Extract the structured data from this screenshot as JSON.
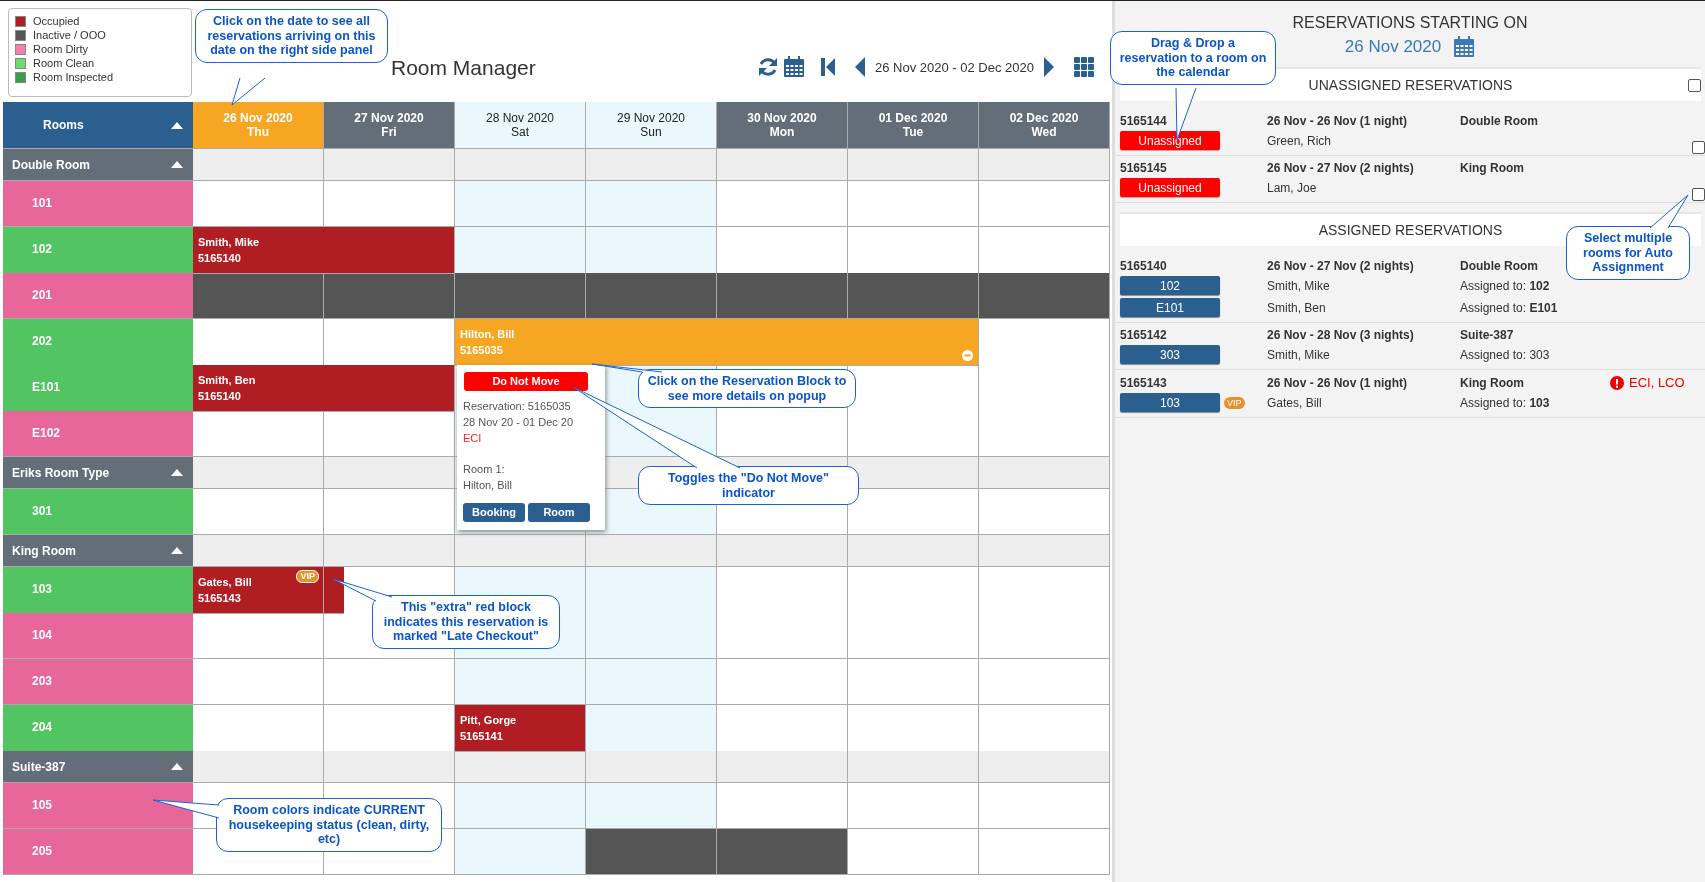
{
  "legend": [
    {
      "label": "Occupied",
      "color": "#b01e24"
    },
    {
      "label": "Inactive / OOO",
      "color": "#555555"
    },
    {
      "label": "Room Dirty",
      "color": "#f47fac"
    },
    {
      "label": "Room Clean",
      "color": "#6ddb6d"
    },
    {
      "label": "Room Inspected",
      "color": "#3a9d4a"
    }
  ],
  "title": "Room Manager",
  "toolbar": {
    "range": "26 Nov 2020 - 02 Dec 2020"
  },
  "calendar": {
    "rooms_header": "Rooms",
    "days": [
      {
        "date": "26 Nov 2020",
        "weekday": "Thu",
        "selected": true,
        "weekend": false
      },
      {
        "date": "27 Nov 2020",
        "weekday": "Fri",
        "selected": false,
        "weekend": false
      },
      {
        "date": "28 Nov 2020",
        "weekday": "Sat",
        "selected": false,
        "weekend": true
      },
      {
        "date": "29 Nov 2020",
        "weekday": "Sun",
        "selected": false,
        "weekend": true
      },
      {
        "date": "30 Nov 2020",
        "weekday": "Mon",
        "selected": false,
        "weekend": false
      },
      {
        "date": "01 Dec 2020",
        "weekday": "Tue",
        "selected": false,
        "weekend": false
      },
      {
        "date": "02 Dec 2020",
        "weekday": "Wed",
        "selected": false,
        "weekend": false
      }
    ],
    "groups": [
      {
        "name": "Double Room",
        "expanded": true,
        "rooms": [
          {
            "name": "101",
            "kind": "dirty",
            "cells": [
              {
                "kind": "free"
              },
              {
                "kind": "free"
              },
              {
                "kind": "free"
              },
              {
                "kind": "free"
              },
              {
                "kind": "free"
              },
              {
                "kind": "free"
              },
              {
                "kind": "free"
              }
            ]
          },
          {
            "name": "102",
            "kind": "clean",
            "cells": [
              {
                "kind": "occupied",
                "guest": "Smith, Mike",
                "number": "5165140",
                "selected": false,
                "late_checkout": false
              },
              {
                "kind": "continued"
              },
              {
                "kind": "free"
              },
              {
                "kind": "free"
              },
              {
                "kind": "free"
              },
              {
                "kind": "free"
              },
              {
                "kind": "free"
              }
            ]
          },
          {
            "name": "201",
            "kind": "dirty",
            "cells": [
              {
                "kind": "inactive"
              },
              {
                "kind": "inactive"
              },
              {
                "kind": "inactive"
              },
              {
                "kind": "inactive"
              },
              {
                "kind": "inactive"
              },
              {
                "kind": "inactive"
              },
              {
                "kind": "inactive"
              }
            ]
          },
          {
            "name": "202",
            "kind": "clean",
            "cells": [
              {
                "kind": "free"
              },
              {
                "kind": "free"
              },
              {
                "kind": "occupied",
                "guest": "Hilton, Bill",
                "number": "5165035",
                "selected": true,
                "late_checkout": false
              },
              {
                "kind": "continued"
              },
              {
                "kind": "continued"
              },
              {
                "kind": "continued"
              },
              {
                "kind": "free"
              }
            ]
          },
          {
            "name": "E101",
            "kind": "clean",
            "cells": [
              {
                "kind": "occupied",
                "guest": "Smith, Ben",
                "number": "5165140",
                "selected": false,
                "late_checkout": false
              },
              {
                "kind": "continued"
              },
              {
                "kind": "free"
              },
              {
                "kind": "free"
              },
              {
                "kind": "free"
              },
              {
                "kind": "free"
              },
              {
                "kind": "free"
              }
            ]
          },
          {
            "name": "E102",
            "kind": "dirty",
            "cells": [
              {
                "kind": "free"
              },
              {
                "kind": "free"
              },
              {
                "kind": "free"
              },
              {
                "kind": "free"
              },
              {
                "kind": "free"
              },
              {
                "kind": "free"
              },
              {
                "kind": "free"
              }
            ]
          }
        ]
      },
      {
        "name": "Eriks Room Type",
        "expanded": true,
        "rooms": [
          {
            "name": "301",
            "kind": "clean",
            "cells": [
              {
                "kind": "free"
              },
              {
                "kind": "free"
              },
              {
                "kind": "free"
              },
              {
                "kind": "free"
              },
              {
                "kind": "free"
              },
              {
                "kind": "free"
              },
              {
                "kind": "free"
              }
            ]
          }
        ]
      },
      {
        "name": "King Room",
        "expanded": true,
        "rooms": [
          {
            "name": "103",
            "kind": "clean",
            "cells": [
              {
                "kind": "occupied",
                "guest": "Gates, Bill",
                "number": "5165143",
                "selected": false,
                "vip_badge": "VIP",
                "late_checkout": true
              },
              {
                "kind": "free"
              },
              {
                "kind": "free"
              },
              {
                "kind": "free"
              },
              {
                "kind": "free"
              },
              {
                "kind": "free"
              },
              {
                "kind": "free"
              }
            ]
          },
          {
            "name": "104",
            "kind": "dirty",
            "cells": [
              {
                "kind": "free"
              },
              {
                "kind": "free"
              },
              {
                "kind": "free"
              },
              {
                "kind": "free"
              },
              {
                "kind": "free"
              },
              {
                "kind": "free"
              },
              {
                "kind": "free"
              }
            ]
          },
          {
            "name": "203",
            "kind": "dirty",
            "cells": [
              {
                "kind": "free"
              },
              {
                "kind": "free"
              },
              {
                "kind": "free"
              },
              {
                "kind": "free"
              },
              {
                "kind": "free"
              },
              {
                "kind": "free"
              },
              {
                "kind": "free"
              }
            ]
          },
          {
            "name": "204",
            "kind": "clean",
            "cells": [
              {
                "kind": "free"
              },
              {
                "kind": "free"
              },
              {
                "kind": "occupied",
                "guest": "Pitt, Gorge",
                "number": "5165141",
                "selected": false,
                "late_checkout": false
              },
              {
                "kind": "free"
              },
              {
                "kind": "free"
              },
              {
                "kind": "free"
              },
              {
                "kind": "free"
              }
            ]
          }
        ]
      },
      {
        "name": "Suite-387",
        "expanded": true,
        "rooms": [
          {
            "name": "105",
            "kind": "dirty",
            "cells": [
              {
                "kind": "free"
              },
              {
                "kind": "free"
              },
              {
                "kind": "free"
              },
              {
                "kind": "free"
              },
              {
                "kind": "free"
              },
              {
                "kind": "free"
              },
              {
                "kind": "free"
              }
            ]
          },
          {
            "name": "205",
            "kind": "dirty",
            "cells": [
              {
                "kind": "free"
              },
              {
                "kind": "free"
              },
              {
                "kind": "free"
              },
              {
                "kind": "inactive"
              },
              {
                "kind": "inactive"
              },
              {
                "kind": "free"
              },
              {
                "kind": "free"
              }
            ]
          }
        ]
      }
    ]
  },
  "popup": {
    "toggle": "Do Not Move",
    "reservation": "Reservation: 5165035",
    "dates": "28 Nov 20 - 01 Dec 20",
    "flag": "ECI",
    "room_label": "Room 1:",
    "guest": "Hilton, Bill",
    "buttons": [
      "Booking",
      "Room"
    ]
  },
  "callouts": [
    "Click on the date to see all reservations arriving on this date on the right side panel",
    "Drag & Drop a reservation to a room on the calendar",
    "Select multiple rooms for Auto Assignment",
    "Click on the Reservation Block to see more details on popup",
    "Toggles the \"Do Not Move\" indicator",
    "This \"extra\" red block indicates this reservation is marked \"Late Checkout\"",
    "Room colors indicate CURRENT housekeeping status (clean, dirty, etc)"
  ],
  "panel": {
    "title": "RESERVATIONS STARTING ON",
    "date": "26 Nov 2020",
    "unassigned_header": "UNASSIGNED RESERVATIONS",
    "unassigned_all_checked": false,
    "unassigned": [
      {
        "id": "5165144",
        "badge": "Unassigned",
        "dates": "26 Nov - 26 Nov (1 night)",
        "guest": "Green, Rich",
        "room_type": "Double Room",
        "checked": false
      },
      {
        "id": "5165145",
        "badge": "Unassigned",
        "dates": "26 Nov - 27 Nov (2 nights)",
        "guest": "Lam, Joe",
        "room_type": "King Room",
        "checked": false
      }
    ],
    "assigned_header": "ASSIGNED RESERVATIONS",
    "assigned": [
      {
        "id": "5165140",
        "dates": "26 Nov - 27 Nov (2 nights)",
        "room_type": "Double Room",
        "lines": [
          {
            "room": "102",
            "guest": "Smith, Mike",
            "assigned": "Assigned to: **102**"
          },
          {
            "room": "E101",
            "guest": "Smith, Ben",
            "assigned": "Assigned to: **E101**"
          }
        ]
      },
      {
        "id": "5165142",
        "dates": "26 Nov - 28 Nov (3 nights)",
        "room_type": "Suite-387",
        "lines": [
          {
            "room": "303",
            "guest": "Smith, Mike",
            "assigned": "Assigned to: 303"
          }
        ]
      },
      {
        "id": "5165143",
        "dates": "26 Nov - 26 Nov (1 night)",
        "room_type": "King Room",
        "alert": "ECI, LCO",
        "lines": [
          {
            "room": "103",
            "vip_badge": "VIP",
            "guest": "Gates, Bill",
            "assigned": "Assigned to: **103**"
          }
        ]
      }
    ]
  }
}
